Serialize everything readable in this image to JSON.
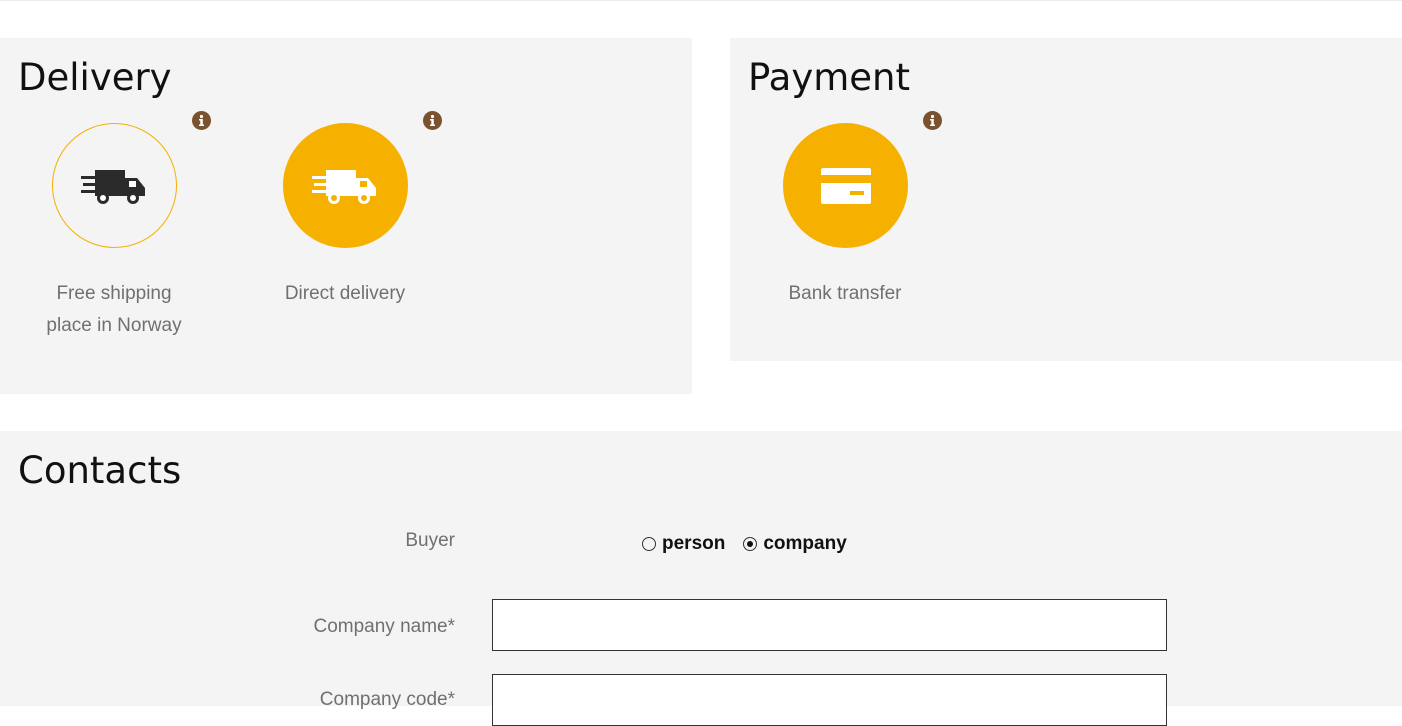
{
  "delivery": {
    "title": "Delivery",
    "options": [
      {
        "label_line1": "Free shipping",
        "label_line2": "place in Norway",
        "icon": "delivery-truck-icon",
        "selected": false
      },
      {
        "label_line1": "Direct delivery",
        "label_line2": "",
        "icon": "delivery-truck-icon",
        "selected": true
      }
    ]
  },
  "payment": {
    "title": "Payment",
    "options": [
      {
        "label_line1": "Bank transfer",
        "icon": "credit-card-icon",
        "selected": true
      }
    ]
  },
  "contacts": {
    "title": "Contacts",
    "buyer_label": "Buyer",
    "buyer_options": [
      {
        "label": "person",
        "checked": false
      },
      {
        "label": "company",
        "checked": true
      }
    ],
    "company_name_label": "Company name*",
    "company_name_value": "",
    "company_code_label": "Company code*",
    "company_code_value": ""
  },
  "colors": {
    "accent": "#f5b000",
    "info_icon": "#7a5230",
    "panel_bg": "#f4f4f4",
    "label_gray": "#707070"
  }
}
